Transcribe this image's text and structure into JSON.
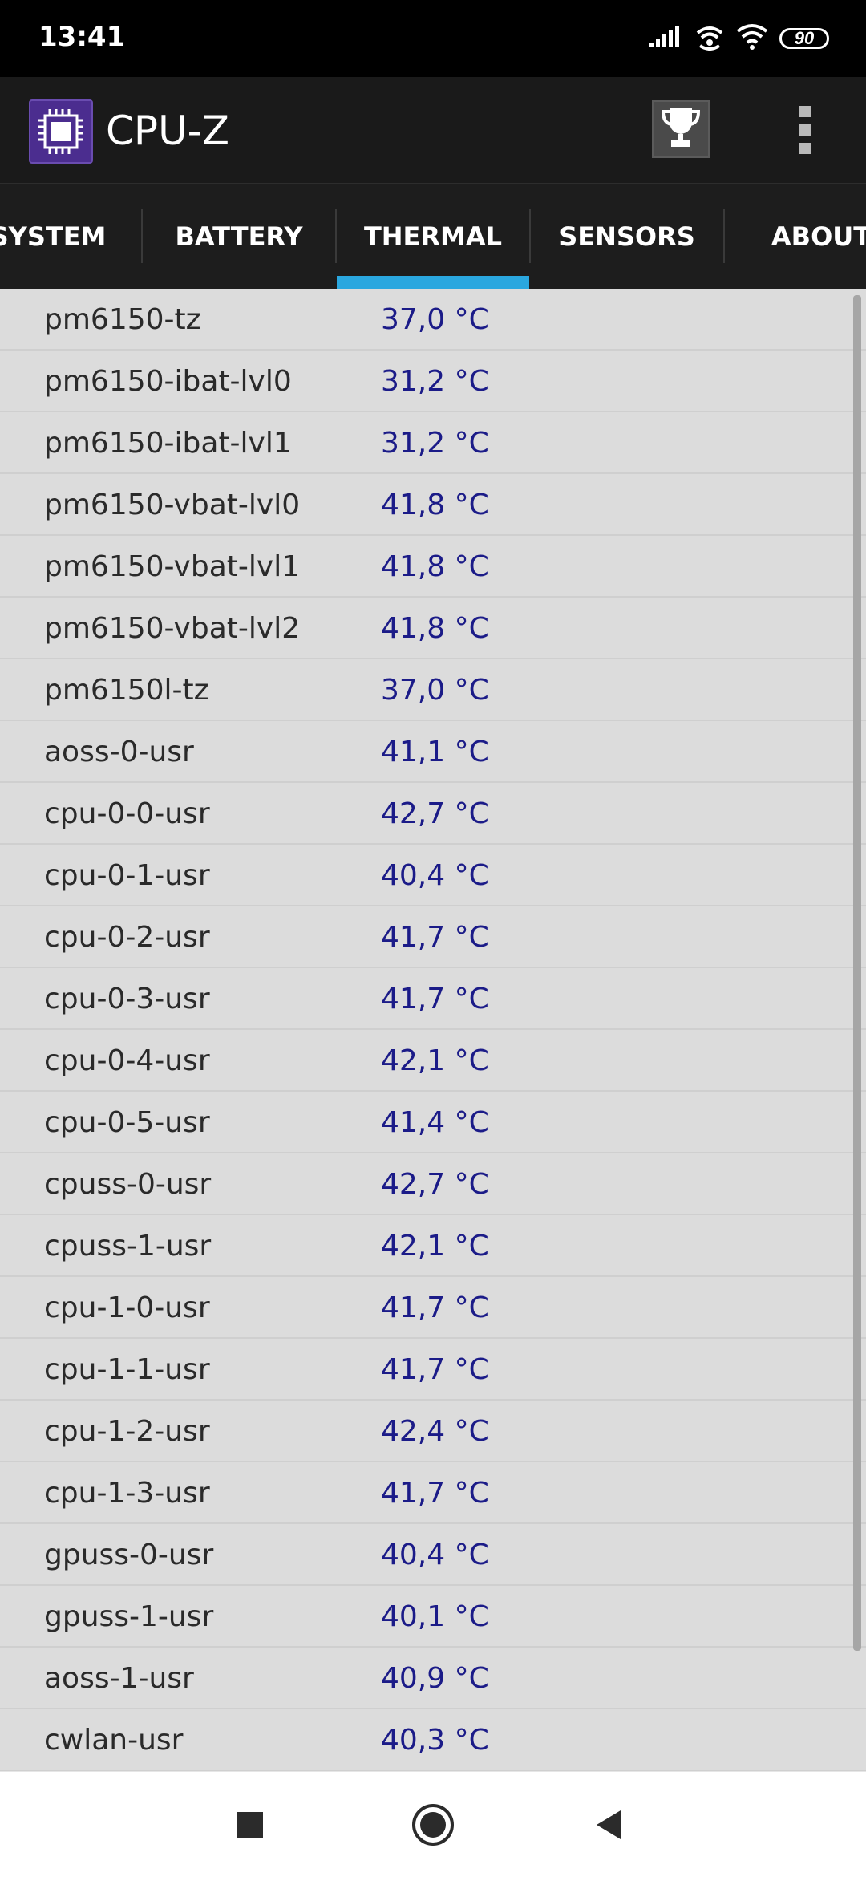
{
  "status_bar": {
    "time": "13:41",
    "battery_level": "90",
    "icons": [
      "signal-icon",
      "hotspot-icon",
      "wifi-icon",
      "battery-icon"
    ]
  },
  "app_bar": {
    "title": "CPU-Z",
    "trophy_icon": "trophy-icon",
    "menu_icon": "overflow-menu-icon"
  },
  "tabs": [
    {
      "label": "SYSTEM",
      "active": false
    },
    {
      "label": "BATTERY",
      "active": false
    },
    {
      "label": "THERMAL",
      "active": true
    },
    {
      "label": "SENSORS",
      "active": false
    },
    {
      "label": "ABOUT",
      "active": false
    }
  ],
  "thermal_rows": [
    {
      "name": "pm6150-tz",
      "value": "37,0 °C"
    },
    {
      "name": "pm6150-ibat-lvl0",
      "value": "31,2 °C"
    },
    {
      "name": "pm6150-ibat-lvl1",
      "value": "31,2 °C"
    },
    {
      "name": "pm6150-vbat-lvl0",
      "value": "41,8 °C"
    },
    {
      "name": "pm6150-vbat-lvl1",
      "value": "41,8 °C"
    },
    {
      "name": "pm6150-vbat-lvl2",
      "value": "41,8 °C"
    },
    {
      "name": "pm6150l-tz",
      "value": "37,0 °C"
    },
    {
      "name": "aoss-0-usr",
      "value": "41,1 °C"
    },
    {
      "name": "cpu-0-0-usr",
      "value": "42,7 °C"
    },
    {
      "name": "cpu-0-1-usr",
      "value": "40,4 °C"
    },
    {
      "name": "cpu-0-2-usr",
      "value": "41,7 °C"
    },
    {
      "name": "cpu-0-3-usr",
      "value": "41,7 °C"
    },
    {
      "name": "cpu-0-4-usr",
      "value": "42,1 °C"
    },
    {
      "name": "cpu-0-5-usr",
      "value": "41,4 °C"
    },
    {
      "name": "cpuss-0-usr",
      "value": "42,7 °C"
    },
    {
      "name": "cpuss-1-usr",
      "value": "42,1 °C"
    },
    {
      "name": "cpu-1-0-usr",
      "value": "41,7 °C"
    },
    {
      "name": "cpu-1-1-usr",
      "value": "41,7 °C"
    },
    {
      "name": "cpu-1-2-usr",
      "value": "42,4 °C"
    },
    {
      "name": "cpu-1-3-usr",
      "value": "41,7 °C"
    },
    {
      "name": "gpuss-0-usr",
      "value": "40,4 °C"
    },
    {
      "name": "gpuss-1-usr",
      "value": "40,1 °C"
    },
    {
      "name": "aoss-1-usr",
      "value": "40,9 °C"
    },
    {
      "name": "cwlan-usr",
      "value": "40,3 °C"
    }
  ],
  "nav_bar": {
    "recents_icon": "recents-square-icon",
    "home_icon": "home-circle-icon",
    "back_icon": "back-triangle-icon"
  },
  "colors": {
    "accent": "#2aa7df",
    "value_text": "#1b1b88",
    "list_background": "#dcdcdc",
    "app_bar": "#1a1a1a"
  }
}
